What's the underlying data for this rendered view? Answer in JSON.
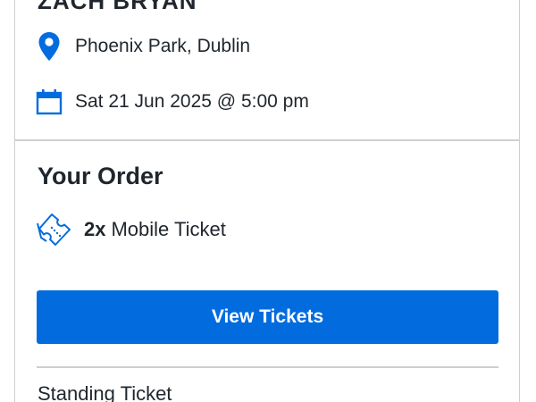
{
  "event": {
    "title": "ZACH BRYAN",
    "venue": "Phoenix Park, Dublin",
    "datetime": "Sat 21 Jun 2025 @ 5:00 pm",
    "venue_icon": "location-pin-icon",
    "date_icon": "calendar-icon"
  },
  "order": {
    "heading": "Your Order",
    "quantity": "2x",
    "ticket_type": "Mobile Ticket",
    "ticket_icon": "mobile-ticket-icon",
    "view_button_label": "View Tickets",
    "section_label": "Standing Ticket"
  },
  "colors": {
    "accent": "#026cdf",
    "text": "#1f262d",
    "divider": "#cfcfcf"
  }
}
